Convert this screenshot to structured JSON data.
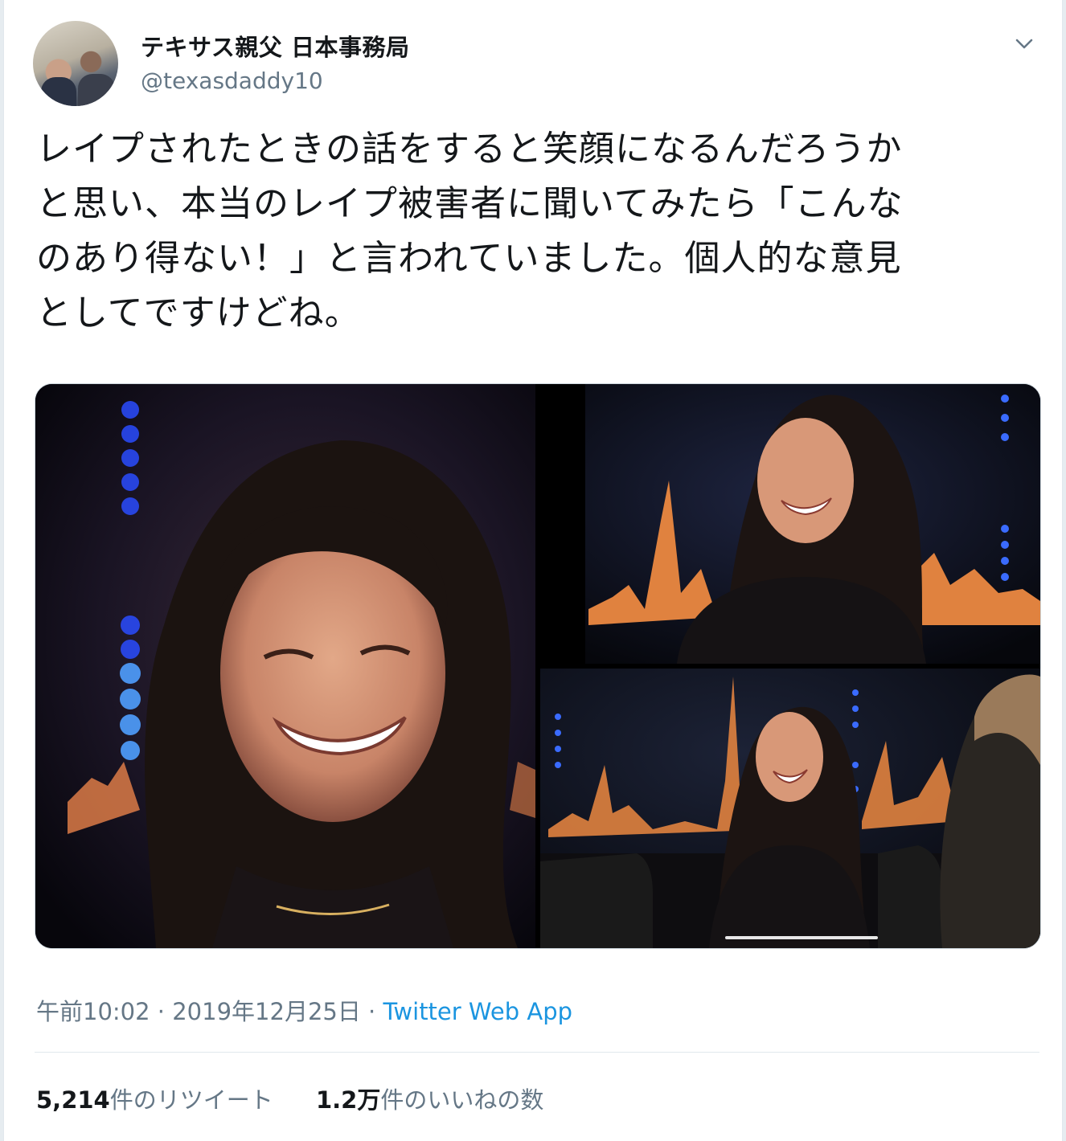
{
  "tweet": {
    "user": {
      "display_name": "テキサス親父 日本事務局",
      "handle": "@texasdaddy10",
      "avatar_icon": "user-avatar"
    },
    "menu_icon": "chevron-down-icon",
    "text_lines": [
      "レイプされたときの話をすると笑顔になるんだろうか",
      "と思い、本当のレイプ被害者に聞いてみたら「こんな",
      "のあり得ない！」と言われていました。個人的な意見",
      "としてですけどね。"
    ],
    "media": {
      "photo_count": 3
    },
    "timestamp": {
      "time": "午前10:02",
      "separator1": " · ",
      "date": "2019年12月25日",
      "separator2": " · ",
      "source": "Twitter Web App"
    },
    "stats": {
      "retweets_count": "5,214",
      "retweets_label": "件のリツイート",
      "likes_count": "1.2万",
      "likes_label": "件のいいねの数"
    }
  },
  "colors": {
    "link": "#1b95e0",
    "secondary_text": "#657786",
    "primary_text": "#14171a",
    "border": "#e1e8ed"
  }
}
